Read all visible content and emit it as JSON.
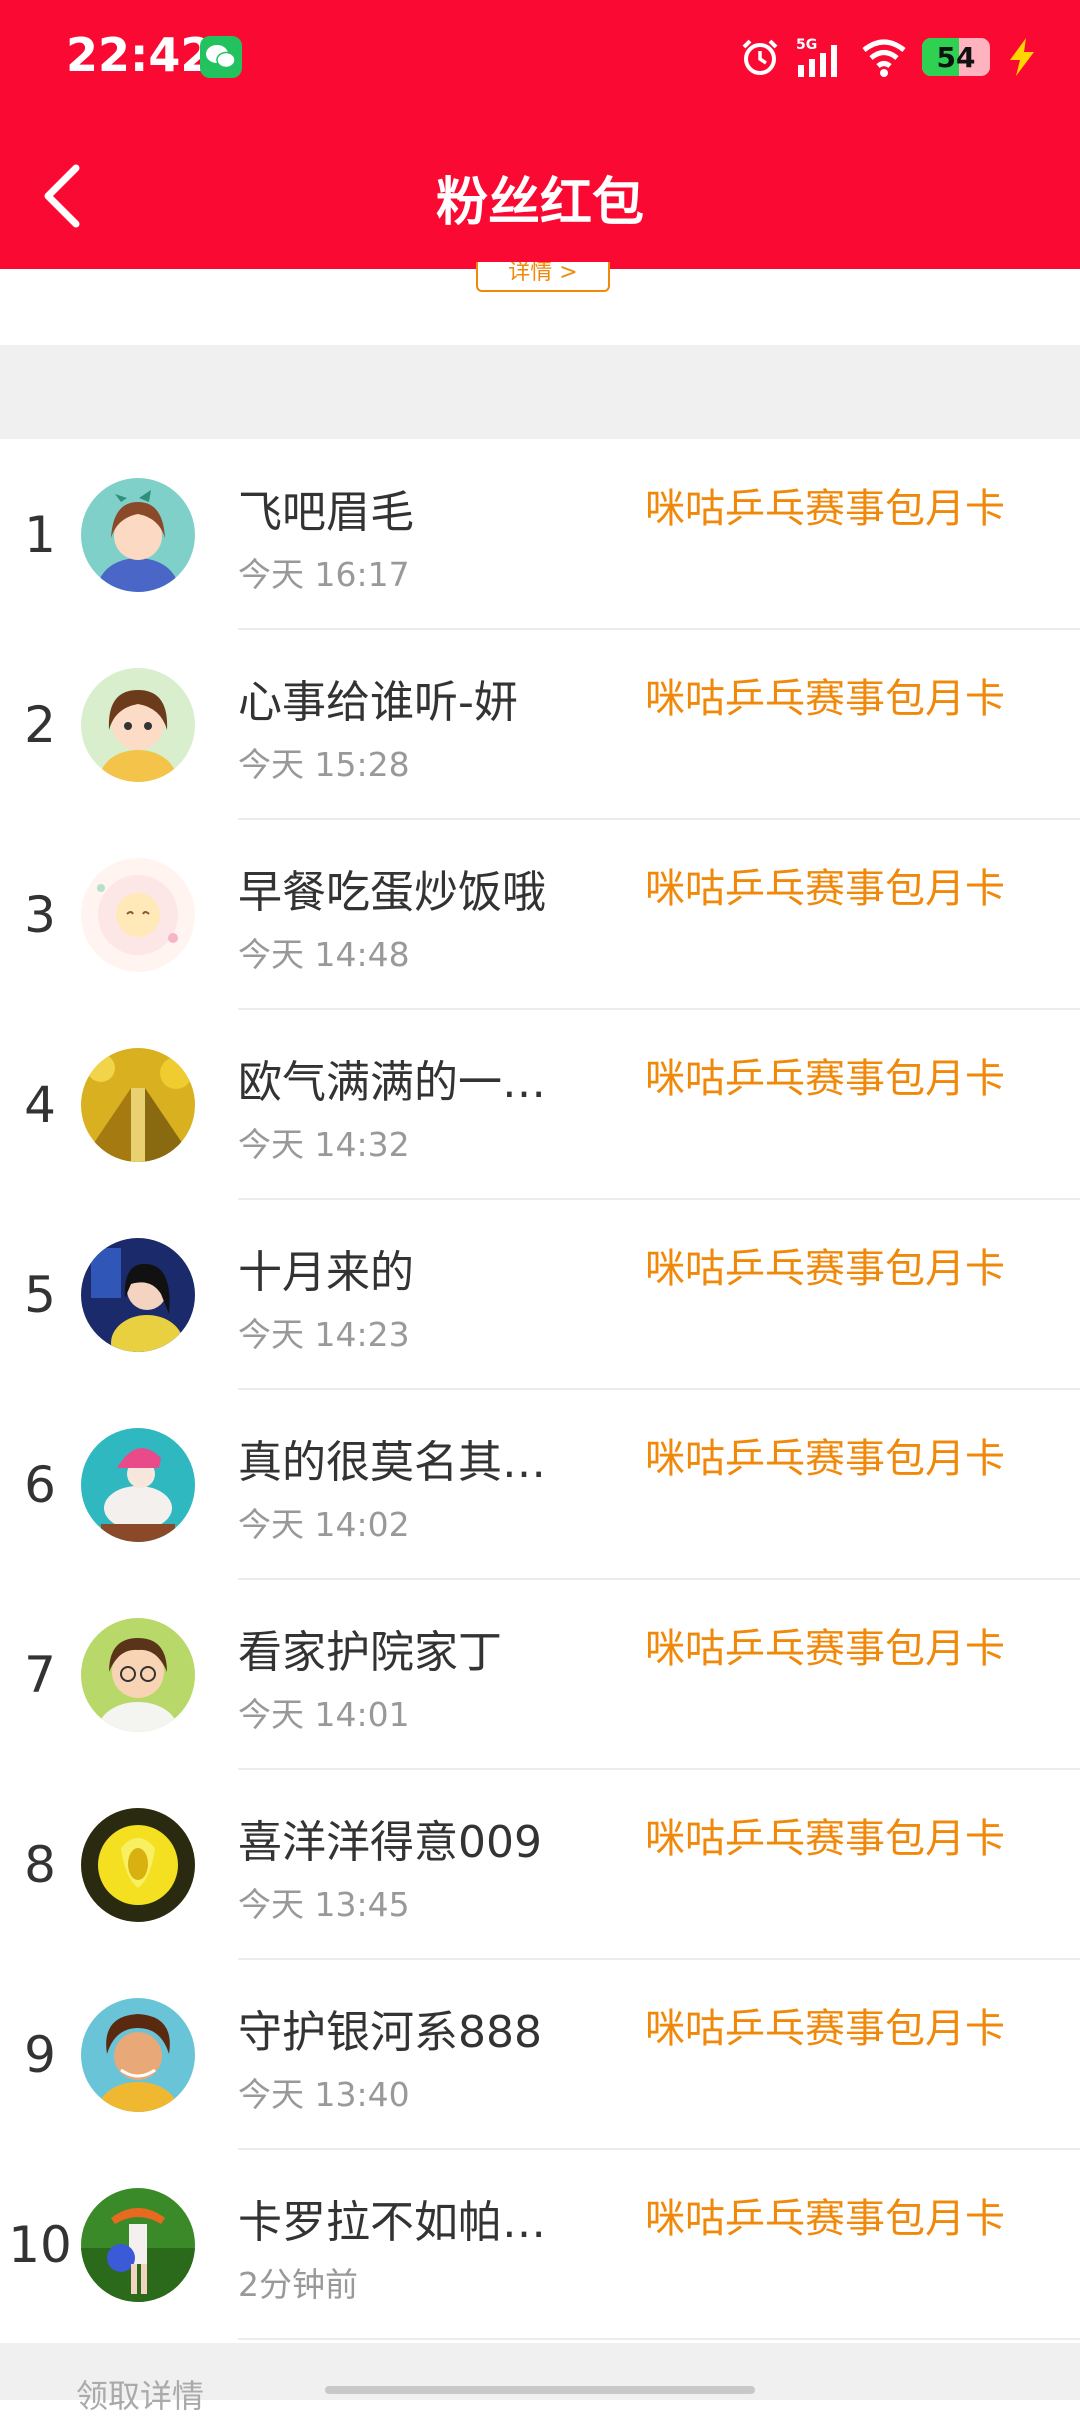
{
  "status_bar": {
    "time": "22:42",
    "battery": "54",
    "battery_level": 0.54,
    "network": "5G"
  },
  "header": {
    "title": "粉丝红包",
    "back_icon": "chevron-left-icon"
  },
  "details_chip": "详情 >",
  "list": [
    {
      "rank": "1",
      "name": "飞吧眉毛",
      "time": "今天 16:17",
      "prize": "咪咕乒乓赛事包月卡"
    },
    {
      "rank": "2",
      "name": "心事给谁听-妍",
      "time": "今天 15:28",
      "prize": "咪咕乒乓赛事包月卡"
    },
    {
      "rank": "3",
      "name": "早餐吃蛋炒饭哦",
      "time": "今天 14:48",
      "prize": "咪咕乒乓赛事包月卡"
    },
    {
      "rank": "4",
      "name": "欧气满满的一…",
      "time": "今天 14:32",
      "prize": "咪咕乒乓赛事包月卡"
    },
    {
      "rank": "5",
      "name": "十月来的",
      "time": "今天 14:23",
      "prize": "咪咕乒乓赛事包月卡"
    },
    {
      "rank": "6",
      "name": "真的很莫名其…",
      "time": "今天 14:02",
      "prize": "咪咕乒乓赛事包月卡"
    },
    {
      "rank": "7",
      "name": "看家护院家丁",
      "time": "今天 14:01",
      "prize": "咪咕乒乓赛事包月卡"
    },
    {
      "rank": "8",
      "name": "喜洋洋得意009",
      "time": "今天 13:45",
      "prize": "咪咕乒乓赛事包月卡"
    },
    {
      "rank": "9",
      "name": "守护银河系888",
      "time": "今天 13:40",
      "prize": "咪咕乒乓赛事包月卡"
    },
    {
      "rank": "10",
      "name": "卡罗拉不如帕…",
      "time": "2分钟前",
      "prize": "咪咕乒乓赛事包月卡"
    }
  ],
  "footer": {
    "label": "领取详情"
  },
  "colors": {
    "header_bg": "#fa0a32",
    "accent_orange": "#f0880a",
    "band_gray": "#f0f0f0"
  }
}
